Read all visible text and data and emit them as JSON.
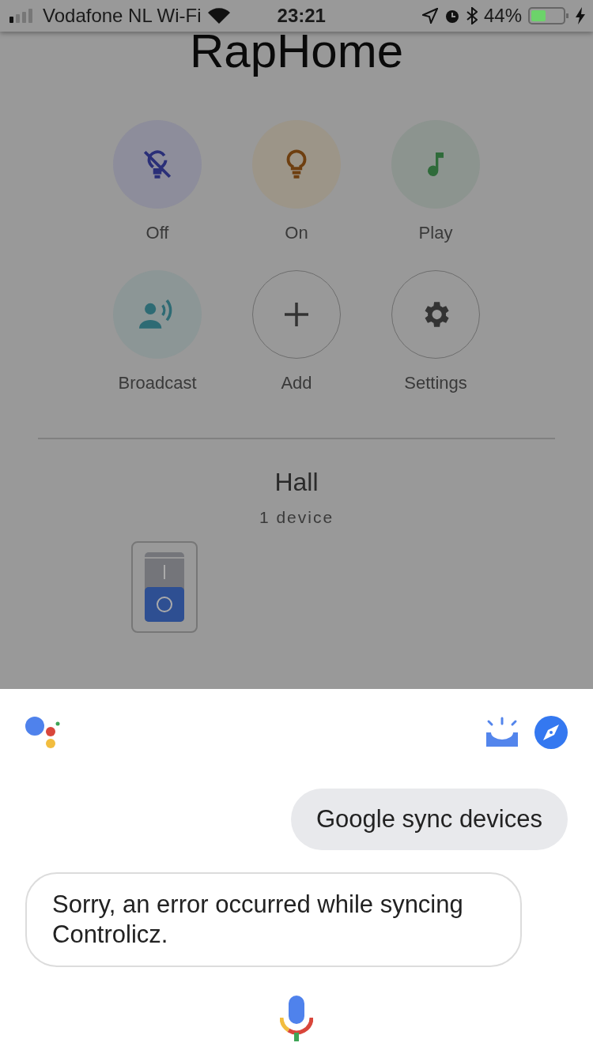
{
  "status_bar": {
    "carrier": "Vodafone NL Wi-Fi",
    "time": "23:21",
    "battery": "44%"
  },
  "title": "RapHome",
  "actions": [
    {
      "kind": "off",
      "label": "Off"
    },
    {
      "kind": "on",
      "label": "On"
    },
    {
      "kind": "play",
      "label": "Play"
    },
    {
      "kind": "broadcast",
      "label": "Broadcast"
    },
    {
      "kind": "add",
      "label": "Add"
    },
    {
      "kind": "settings",
      "label": "Settings"
    }
  ],
  "room": {
    "name": "Hall",
    "count": "1 device",
    "devices": [
      {
        "kind": "switch",
        "on": false
      }
    ]
  },
  "assistant": {
    "messages": [
      {
        "kind": "user",
        "text": "Google sync devices"
      },
      {
        "kind": "reply",
        "text": "Sorry, an error occurred while syncing Controlicz."
      }
    ]
  }
}
